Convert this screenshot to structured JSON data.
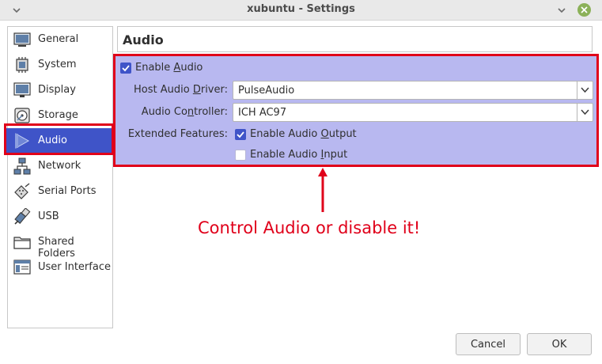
{
  "window": {
    "title": "xubuntu - Settings"
  },
  "sidebar": {
    "items": [
      {
        "label": "General",
        "icon": "general-icon"
      },
      {
        "label": "System",
        "icon": "system-icon"
      },
      {
        "label": "Display",
        "icon": "display-icon"
      },
      {
        "label": "Storage",
        "icon": "storage-icon"
      },
      {
        "label": "Audio",
        "icon": "audio-icon",
        "selected": true
      },
      {
        "label": "Network",
        "icon": "network-icon"
      },
      {
        "label": "Serial Ports",
        "icon": "serial-ports-icon"
      },
      {
        "label": "USB",
        "icon": "usb-icon"
      },
      {
        "label": "Shared Folders",
        "icon": "shared-folders-icon"
      },
      {
        "label": "User Interface",
        "icon": "user-interface-icon"
      }
    ]
  },
  "page": {
    "title": "Audio"
  },
  "audio": {
    "enable_audio": {
      "label_pre": "Enable ",
      "label_u": "A",
      "label_post": "udio",
      "checked": true
    },
    "host_driver": {
      "label_pre": "Host Audio ",
      "label_u": "D",
      "label_post": "river:",
      "value": "PulseAudio"
    },
    "controller": {
      "label_pre": "Audio Co",
      "label_u": "n",
      "label_post": "troller:",
      "value": "ICH AC97"
    },
    "extended_features_label": "Extended Features:",
    "output": {
      "label_pre": "Enable Audio ",
      "label_u": "O",
      "label_post": "utput",
      "checked": true
    },
    "input": {
      "label_pre": "Enable Audio ",
      "label_u": "I",
      "label_post": "nput",
      "checked": false
    }
  },
  "annotation": {
    "text": "Control Audio or disable it!",
    "color": "#e0001a"
  },
  "buttons": {
    "cancel": "Cancel",
    "ok": "OK"
  },
  "colors": {
    "accent": "#3f54c8",
    "highlight_box": "#b8b8f0",
    "outline": "#e0001a"
  }
}
